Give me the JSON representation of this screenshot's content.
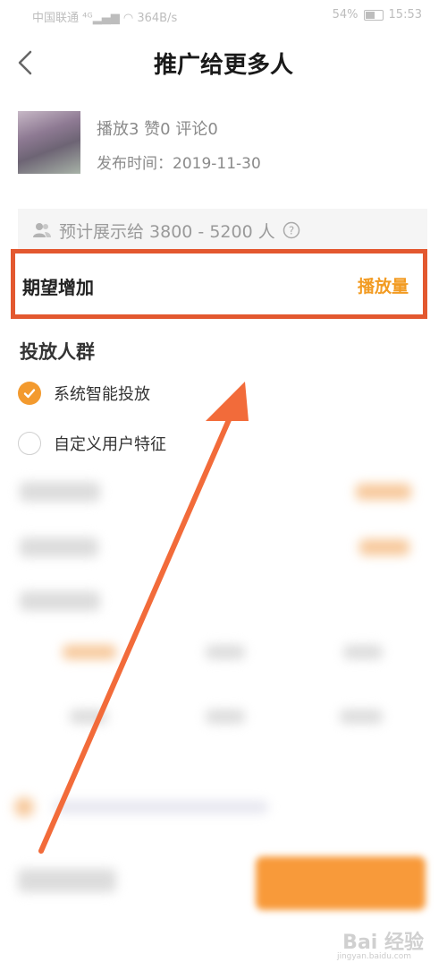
{
  "status_bar": {
    "carrier": "中国联通",
    "network": "364B/s",
    "battery": "54%",
    "time": "15:53"
  },
  "header": {
    "title": "推广给更多人"
  },
  "video": {
    "stats": "播放3  赞0  评论0",
    "publish_time": "发布时间：2019-11-30"
  },
  "estimate": {
    "text": "预计展示给 3800 - 5200 人"
  },
  "expect": {
    "label": "期望增加",
    "value": "播放量"
  },
  "audience": {
    "title": "投放人群",
    "options": [
      {
        "label": "系统智能投放",
        "checked": true
      },
      {
        "label": "自定义用户特征",
        "checked": false
      }
    ]
  },
  "colors": {
    "accent": "#f39a2e",
    "highlight_border": "#e3582f",
    "arrow": "#f26b3a"
  },
  "watermark": {
    "brand": "Bai 经验",
    "url": "jingyan.baidu.com"
  }
}
